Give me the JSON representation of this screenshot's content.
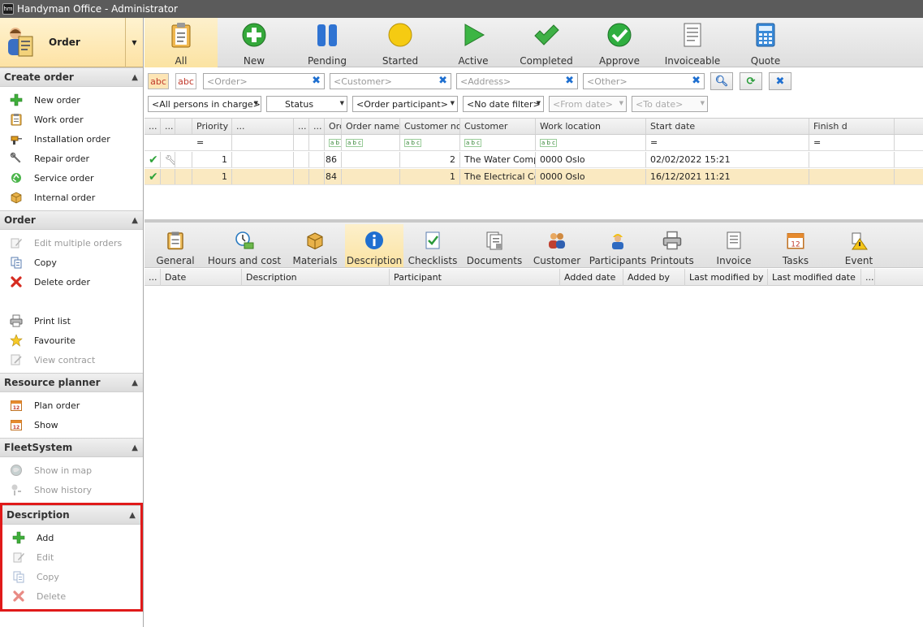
{
  "window": {
    "title": "Handyman Office - Administrator",
    "app_icon": "hm"
  },
  "sidebar": {
    "module_label": "Order",
    "sections": [
      {
        "title": "Create order",
        "items": [
          {
            "label": "New order",
            "icon": "plus-icon",
            "enabled": true
          },
          {
            "label": "Work order",
            "icon": "clipboard-icon",
            "enabled": true
          },
          {
            "label": "Installation order",
            "icon": "drill-icon",
            "enabled": true
          },
          {
            "label": "Repair order",
            "icon": "wrench-icon",
            "enabled": true
          },
          {
            "label": "Service order",
            "icon": "recycle-icon",
            "enabled": true
          },
          {
            "label": "Internal order",
            "icon": "box-icon",
            "enabled": true
          }
        ]
      },
      {
        "title": "Order",
        "items": [
          {
            "label": "Edit multiple orders",
            "icon": "edit-icon",
            "enabled": false
          },
          {
            "label": "Copy",
            "icon": "copy-icon",
            "enabled": true
          },
          {
            "label": "Delete order",
            "icon": "delete-icon",
            "enabled": true
          },
          {
            "label": "",
            "spacer": true
          },
          {
            "label": "Print list",
            "icon": "printer-icon",
            "enabled": true
          },
          {
            "label": "Favourite",
            "icon": "star-icon",
            "enabled": true
          },
          {
            "label": "View contract",
            "icon": "contract-icon",
            "enabled": false
          }
        ]
      },
      {
        "title": "Resource planner",
        "items": [
          {
            "label": "Plan order",
            "icon": "calendar-icon",
            "enabled": true
          },
          {
            "label": "Show",
            "icon": "calendar-icon",
            "enabled": true
          }
        ]
      },
      {
        "title": "FleetSystem",
        "items": [
          {
            "label": "Show in map",
            "icon": "map-icon",
            "enabled": false
          },
          {
            "label": "Show history",
            "icon": "history-icon",
            "enabled": false
          }
        ]
      },
      {
        "title": "Description",
        "items": [
          {
            "label": "Add",
            "icon": "plus-icon",
            "enabled": true
          },
          {
            "label": "Edit",
            "icon": "edit-icon",
            "enabled": false
          },
          {
            "label": "Copy",
            "icon": "copy-icon",
            "enabled": false
          },
          {
            "label": "Delete",
            "icon": "delete-icon",
            "enabled": false
          }
        ]
      }
    ]
  },
  "toolbar": {
    "buttons": [
      {
        "label": "All",
        "icon": "clipboard-icon",
        "selected": true
      },
      {
        "label": "New",
        "icon": "plus-circle-icon",
        "selected": false
      },
      {
        "label": "Pending",
        "icon": "pause-icon",
        "selected": false
      },
      {
        "label": "Started",
        "icon": "circle-yellow-icon",
        "selected": false
      },
      {
        "label": "Active",
        "icon": "play-icon",
        "selected": false
      },
      {
        "label": "Completed",
        "icon": "checkmark-icon",
        "selected": false
      },
      {
        "label": "Approve",
        "icon": "check-circle-icon",
        "selected": false
      },
      {
        "label": "Invoiceable",
        "icon": "document-icon",
        "selected": false
      },
      {
        "label": "Quote",
        "icon": "calculator-icon",
        "selected": false
      }
    ]
  },
  "filters": {
    "abc1": "abc",
    "abc2": "abc",
    "order": "<Order>",
    "customer": "<Customer>",
    "address": "<Address>",
    "other": "<Other>",
    "persons": "<All persons in charge>",
    "status": "Status",
    "participant": "<Order participant>",
    "date_filter": "<No date filter>",
    "from_date": "<From date>",
    "to_date": "<To date>"
  },
  "grid": {
    "columns": [
      "...",
      "...",
      "",
      "Priority",
      "...",
      "...",
      "...",
      "Order n...",
      "Order name",
      "Customer no.",
      "Customer",
      "Work location",
      "Start date",
      "Finish d"
    ],
    "filter_eq": "=",
    "rows": [
      {
        "priority": "1",
        "order_no": "86",
        "order_name": "",
        "customer_no": "2",
        "customer": "The Water Company",
        "work_location": "0000 Oslo",
        "start_date": "02/02/2022 15:21",
        "selected": false
      },
      {
        "priority": "1",
        "order_no": "84",
        "order_name": "",
        "customer_no": "1",
        "customer": "The Electrical Company",
        "work_location": "0000 Oslo",
        "start_date": "16/12/2021 11:21",
        "selected": true
      }
    ]
  },
  "detail_tabs": [
    {
      "label": "General",
      "icon": "clipboard-icon",
      "selected": false
    },
    {
      "label": "Hours and cost",
      "icon": "clock-money-icon",
      "selected": false
    },
    {
      "label": "Materials",
      "icon": "box-icon",
      "selected": false
    },
    {
      "label": "Description",
      "icon": "info-icon",
      "selected": true
    },
    {
      "label": "Checklists",
      "icon": "checklist-icon",
      "selected": false
    },
    {
      "label": "Documents",
      "icon": "documents-icon",
      "selected": false
    },
    {
      "label": "Customer",
      "icon": "people-icon",
      "selected": false
    },
    {
      "label": "Participants",
      "icon": "worker-icon",
      "selected": false
    },
    {
      "label": "Printouts",
      "icon": "printer-icon",
      "selected": false
    },
    {
      "label": "Invoice",
      "icon": "invoice-icon",
      "selected": false
    },
    {
      "label": "Tasks",
      "icon": "calendar-icon",
      "selected": false
    },
    {
      "label": "Event",
      "icon": "event-warning-icon",
      "selected": false
    }
  ],
  "detail_grid": {
    "columns": [
      "...",
      "Date",
      "Description",
      "Participant",
      "Added date",
      "Added by",
      "Last modified by",
      "Last modified date",
      "..."
    ]
  },
  "colors": {
    "selected_row": "#fae9c1",
    "highlight_border": "#e01a1a",
    "toolbar_selected": "#fbe3a2"
  }
}
